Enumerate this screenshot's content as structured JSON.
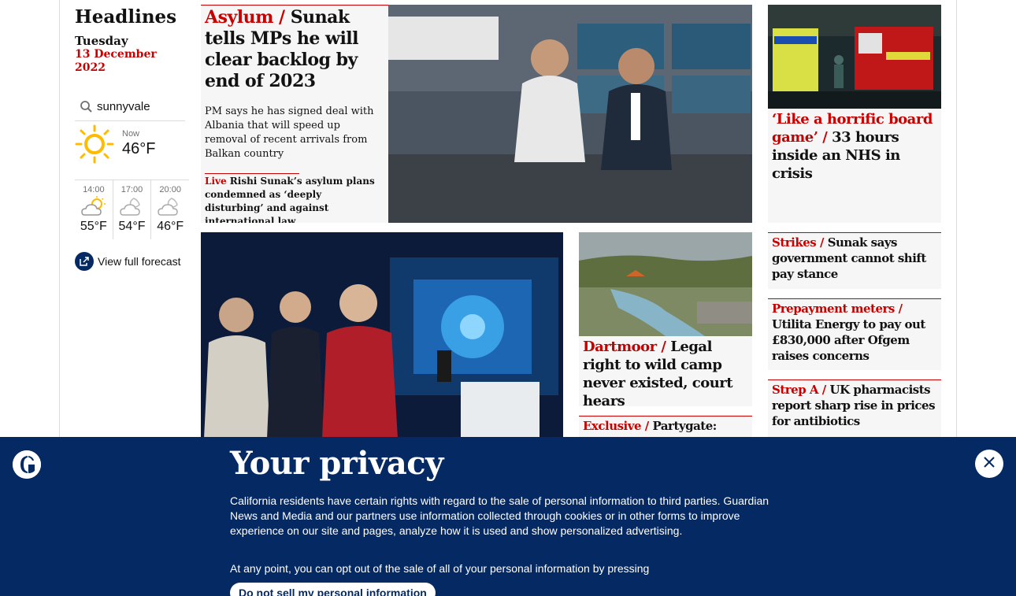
{
  "section": {
    "title": "Headlines",
    "day": "Tuesday",
    "date": "13 December 2022"
  },
  "weather": {
    "location": "sunnyvale",
    "now_label": "Now",
    "now_temp": "46°F",
    "forecast": [
      {
        "time": "14:00",
        "temp": "55°F",
        "icon": "partly-cloudy-icon"
      },
      {
        "time": "17:00",
        "temp": "54°F",
        "icon": "cloudy-night-icon"
      },
      {
        "time": "20:00",
        "temp": "46°F",
        "icon": "cloudy-night-icon"
      }
    ],
    "full_forecast_label": "View full forecast"
  },
  "stories": {
    "main": {
      "kicker": "Asylum /",
      "headline": "Sunak tells MPs he will clear backlog by end of 2023",
      "standfirst": "PM says he has signed deal with Albania that will speed up removal of recent arrivals from Balkan country",
      "live_label": "Live",
      "live_text": "Rishi Sunak’s asylum plans condemned as ‘deeply disturbing’ and against international law"
    },
    "nhs": {
      "kicker": "‘Like a horrific board game’ /",
      "headline": "33 hours inside an NHS in crisis"
    },
    "dartmoor": {
      "kicker": "Dartmoor /",
      "headline": "Legal right to wild camp never existed, court hears"
    },
    "partygate": {
      "kicker": "Exclusive /",
      "headline": "Partygate:"
    },
    "strikes": {
      "kicker": "Strikes /",
      "headline": "Sunak says government cannot shift pay stance"
    },
    "prepayment": {
      "kicker": "Prepayment meters /",
      "headline": "Utilita Energy to pay out £830,000 after Ofgem raises concerns"
    },
    "strep": {
      "kicker": "Strep A /",
      "headline": "UK pharmacists report sharp rise in prices for antibiotics"
    }
  },
  "consent": {
    "title": "Your privacy",
    "body": "California residents have certain rights with regard to the sale of personal information to third parties. Guardian News and Media and our partners use information collected through cookies or in other forms to improve experience on our site and pages, analyze how it is used and show personalized advertising.",
    "body2": "At any point, you can opt out of the sale of all of your personal information by pressing",
    "button_label": "Do not sell my personal information"
  },
  "colors": {
    "accent_red": "#c70000",
    "brand_blue": "#052962",
    "card_bg": "#f6f6f6"
  }
}
